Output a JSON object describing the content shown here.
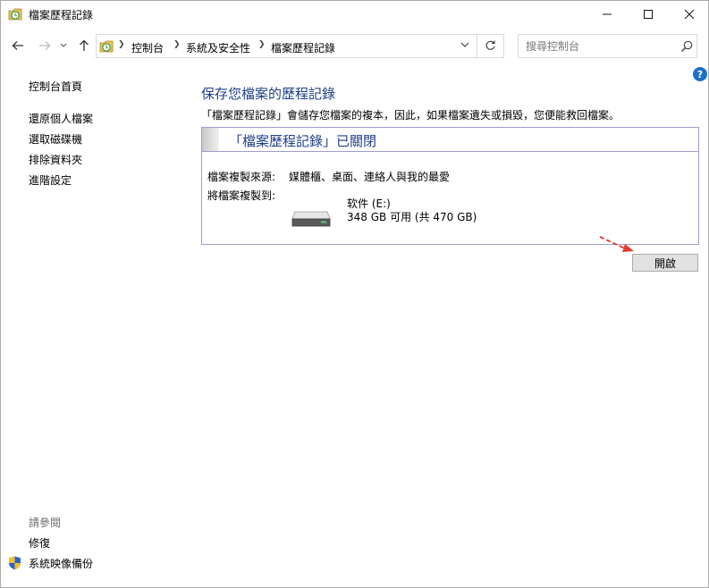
{
  "window": {
    "title": "檔案歷程記錄"
  },
  "address": {
    "breadcrumbs": [
      "控制台",
      "系統及安全性",
      "檔案歷程記錄"
    ]
  },
  "search": {
    "placeholder": "搜尋控制台"
  },
  "help": {
    "label": "?"
  },
  "sidebar": {
    "home": "控制台首頁",
    "items": [
      "還原個人檔案",
      "選取磁碟機",
      "排除資料夾",
      "進階設定"
    ],
    "see_also_title": "請參閱",
    "see_also": [
      "修復",
      "系統映像備份"
    ]
  },
  "main": {
    "title": "保存您檔案的歷程記錄",
    "description": "「檔案歷程記錄」會儲存您檔案的複本，因此，如果檔案遺失或損毀，您便能救回檔案。",
    "status": "「檔案歷程記錄」已關閉",
    "source_label": "檔案複製來源:",
    "source_value": "媒體櫃、桌面、連絡人與我的最愛",
    "dest_label": "將檔案複製到:",
    "drive_name": "软件 (E:)",
    "drive_space": "348 GB 可用 (共 470 GB)",
    "turn_on": "開啟"
  },
  "colors": {
    "link_blue": "#1e3f8a",
    "panel_border": "#9e9ec9",
    "help_blue": "#1e6fc8",
    "annotation_red": "#e53b2c"
  },
  "icons": {
    "title": "file-history-icon",
    "back": "back-arrow-icon",
    "forward": "forward-arrow-icon",
    "recent": "chevron-down-icon",
    "up": "up-arrow-icon",
    "refresh": "refresh-icon",
    "search": "search-icon",
    "drive": "hard-drive-icon",
    "shield": "shield-icon"
  }
}
